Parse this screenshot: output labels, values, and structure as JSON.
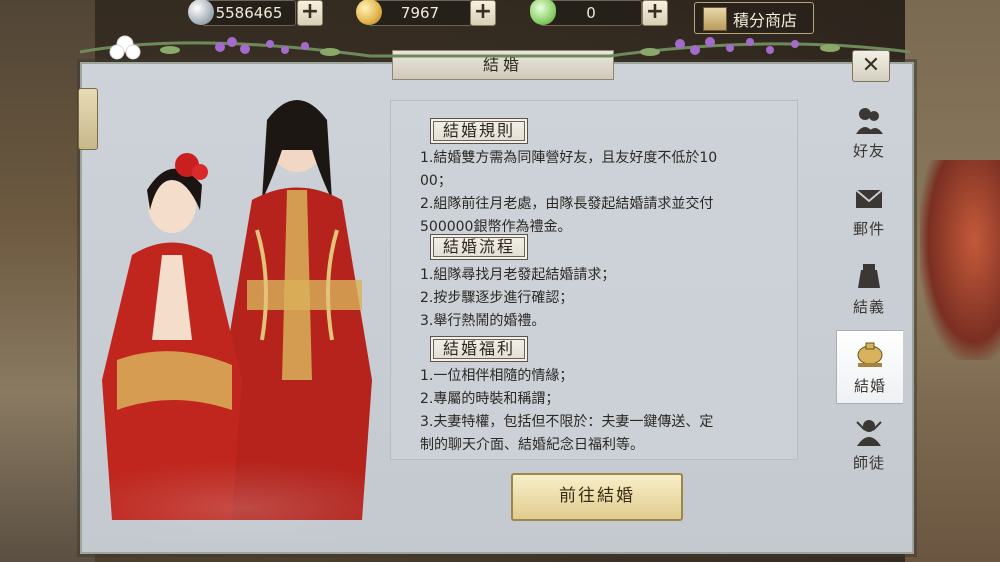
{
  "currencies": [
    {
      "value": "5586465",
      "icon": "silver-coin-icon"
    },
    {
      "value": "7967",
      "icon": "gold-coin-icon"
    },
    {
      "value": "0",
      "icon": "jade-ingot-icon"
    }
  ],
  "shop": {
    "label": "積分商店"
  },
  "panel": {
    "title": "結婚",
    "close_glyph": "✕"
  },
  "sections": [
    {
      "heading": "結婚規則",
      "lines": [
        "1.結婚雙方需為同陣營好友，且友好度不低於10",
        "00；",
        "2.組隊前往月老處，由隊長發起結婚請求並交付",
        "500000銀幣作為禮金。"
      ]
    },
    {
      "heading": "結婚流程",
      "lines": [
        "1.組隊尋找月老發起結婚請求；",
        "2.按步驟逐步進行確認；",
        "3.舉行熱鬧的婚禮。"
      ]
    },
    {
      "heading": "結婚福利",
      "lines": [
        "1.一位相伴相隨的情緣；",
        "2.專屬的時裝和稱謂；",
        "3.夫妻特權，包括但不限於：夫妻一鍵傳送、定",
        "制的聊天介面、結婚紀念日福利等。"
      ]
    }
  ],
  "action": {
    "label": "前往結婚"
  },
  "tabs": [
    {
      "label": "好友",
      "icon": "friends-icon",
      "active": false
    },
    {
      "label": "郵件",
      "icon": "mail-icon",
      "active": false
    },
    {
      "label": "結義",
      "icon": "sworn-brothers-icon",
      "active": false
    },
    {
      "label": "結婚",
      "icon": "marriage-bell-icon",
      "active": true
    },
    {
      "label": "師徒",
      "icon": "master-apprentice-icon",
      "active": false
    }
  ],
  "colors": {
    "accent_red": "#b5231c",
    "gold": "#d9b25a",
    "panel_bg": "#c7cdd2"
  }
}
